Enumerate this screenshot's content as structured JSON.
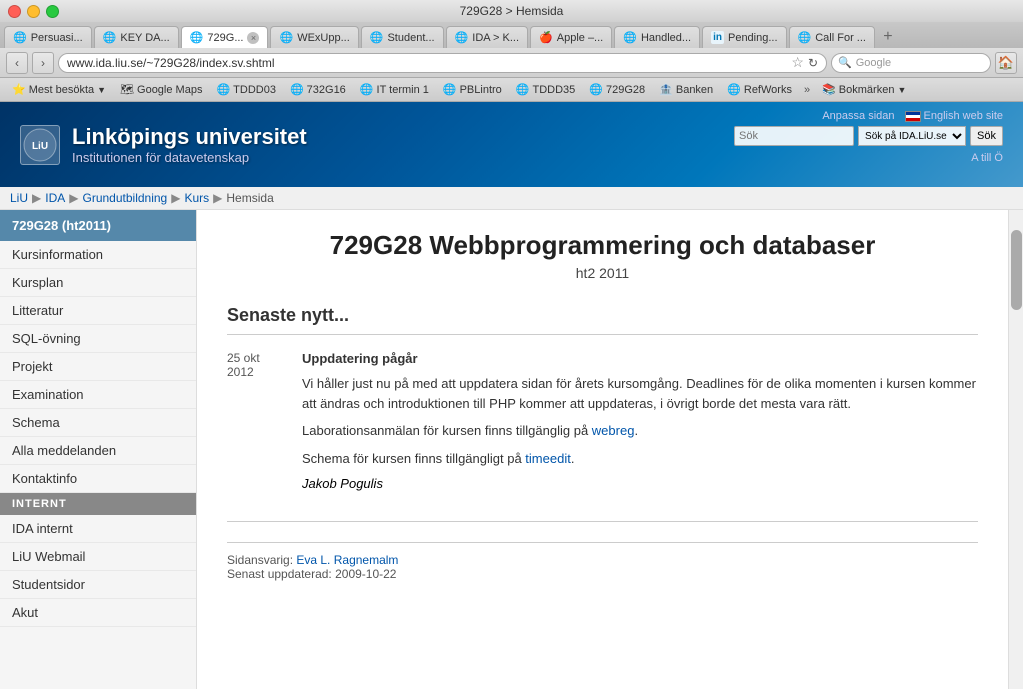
{
  "titlebar": {
    "title": "729G28 > Hemsida"
  },
  "tabs": [
    {
      "label": "Persuasi...",
      "icon": "🌐",
      "active": false
    },
    {
      "label": "KEY DA...",
      "icon": "🌐",
      "active": false
    },
    {
      "label": "729G...",
      "icon": "🌐",
      "active": true
    },
    {
      "label": "WExUpp...",
      "icon": "🌐",
      "active": false
    },
    {
      "label": "Student...",
      "icon": "🌐",
      "active": false
    },
    {
      "label": "IDA > K...",
      "icon": "🌐",
      "active": false
    },
    {
      "label": "Apple –...",
      "icon": "🍎",
      "active": false
    },
    {
      "label": "Handled...",
      "icon": "🌐",
      "active": false
    },
    {
      "label": "Pending...",
      "icon": "in",
      "active": false
    },
    {
      "label": "Call For ...",
      "icon": "🌐",
      "active": false
    }
  ],
  "addressbar": {
    "url": "www.ida.liu.se/~729G28/index.sv.shtml",
    "search_placeholder": "Google",
    "search_label": "Google"
  },
  "bookmarks": [
    {
      "label": "Mest besökta",
      "icon": "⭐",
      "dropdown": true
    },
    {
      "label": "Google Maps",
      "icon": "🗺"
    },
    {
      "label": "TDDD03",
      "icon": "🌐"
    },
    {
      "label": "732G16",
      "icon": "🌐"
    },
    {
      "label": "IT termin 1",
      "icon": "🌐"
    },
    {
      "label": "PBLintro",
      "icon": "🌐"
    },
    {
      "label": "TDDD35",
      "icon": "🌐"
    },
    {
      "label": "729G28",
      "icon": "🌐"
    },
    {
      "label": "Banken",
      "icon": "🏦"
    },
    {
      "label": "RefWorks",
      "icon": "🌐"
    },
    {
      "label": "Bokmärken",
      "icon": "📚",
      "dropdown": true
    }
  ],
  "liu_header": {
    "logo_text": "LiU",
    "university_name": "Linköpings universitet",
    "department": "Institutionen för datavetenskap",
    "links": {
      "anpassa": "Anpassa sidan",
      "english": "English web site"
    },
    "search_placeholder": "Sök",
    "search_option": "Sök på IDA.LiU.se",
    "search_btn": "Sök",
    "a_till": "A till Ö"
  },
  "breadcrumb": {
    "items": [
      "LiU",
      "IDA",
      "Grundutbildning",
      "Kurs",
      "Hemsida"
    ]
  },
  "sidebar": {
    "current": "729G28 (ht2011)",
    "items": [
      {
        "label": "Kursinformation"
      },
      {
        "label": "Kursplan"
      },
      {
        "label": "Litteratur"
      },
      {
        "label": "SQL-övning"
      },
      {
        "label": "Projekt"
      },
      {
        "label": "Examination"
      },
      {
        "label": "Schema"
      },
      {
        "label": "Alla meddelanden"
      },
      {
        "label": "Kontaktinfo"
      }
    ],
    "section_internt": "INTERNT",
    "internt_items": [
      {
        "label": "IDA internt"
      },
      {
        "label": "LiU Webmail"
      },
      {
        "label": "Studentsidor"
      },
      {
        "label": "Akut"
      }
    ]
  },
  "main": {
    "page_title": "729G28 Webbprogrammering och databaser",
    "page_subtitle": "ht2 2011",
    "news_heading": "Senaste nytt...",
    "news_date": "25 okt",
    "news_year": "2012",
    "news_headline": "Uppdatering pågår",
    "news_body1": "Vi håller just nu på med att uppdatera sidan för årets kursomgång. Deadlines för de olika momenten i kursen kommer att ändras och introduktionen till PHP kommer att uppdateras, i övrigt borde det mesta vara rätt.",
    "news_body2": "Laborationsanmälan för kursen finns tillgänglig på ",
    "news_link1_text": "webreg",
    "news_link1_url": "#",
    "news_body3": "Schema för kursen finns tillgängligt på ",
    "news_link2_text": "timeedit",
    "news_link2_url": "#",
    "news_author": "Jakob Pogulis",
    "footer_sidansvarig": "Sidansvarig: ",
    "footer_link_text": "Eva L. Ragnemalm",
    "footer_updated_label": "Senast uppdaterad: ",
    "footer_updated_date": "2009-10-22"
  }
}
